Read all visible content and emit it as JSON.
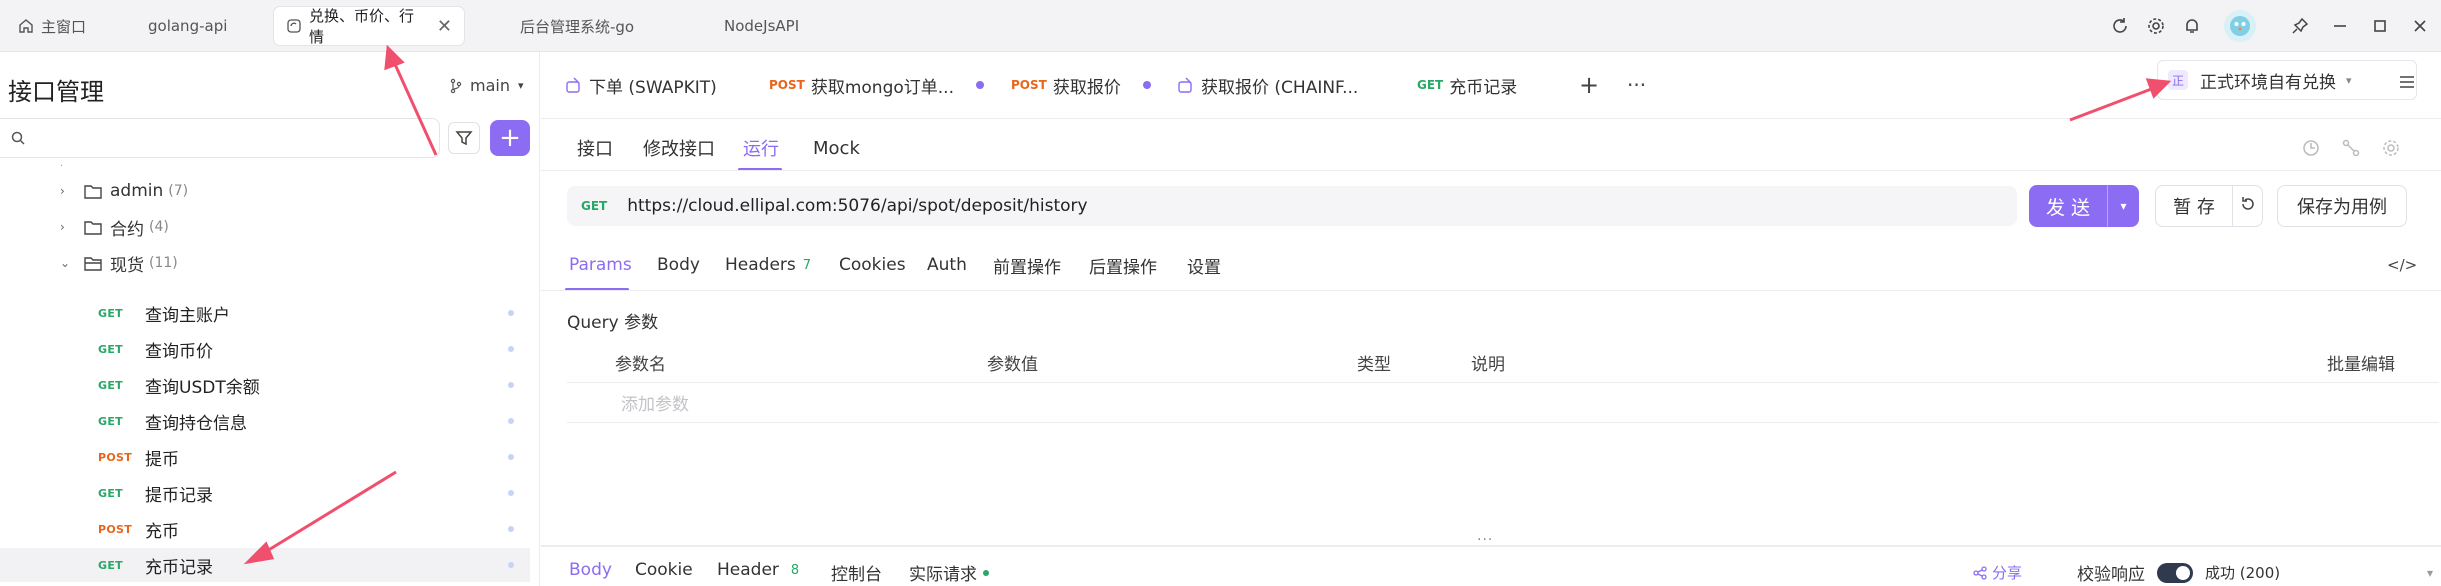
{
  "window_tabs": [
    {
      "label": "主窗口",
      "icon": "home-icon"
    },
    {
      "label": "golang-api"
    },
    {
      "label": "兑换、币价、行情",
      "icon": "tab-sync-icon",
      "active": true
    },
    {
      "label": "后台管理系统-go"
    },
    {
      "label": "NodeJsAPI"
    }
  ],
  "window_controls": [
    "refresh-icon",
    "settings-icon",
    "bell-icon",
    "avatar",
    "pin-icon",
    "minimize-icon",
    "maximize-icon",
    "close-icon"
  ],
  "sidebar": {
    "title": "接口管理",
    "branch": "main",
    "search_placeholder": "",
    "folders": [
      {
        "name": "admin",
        "count": "(7)"
      },
      {
        "name": "合约",
        "count": "(4)"
      },
      {
        "name": "现货",
        "count": "(11)"
      }
    ],
    "apis": [
      {
        "method": "GET",
        "name": "查询主账户"
      },
      {
        "method": "GET",
        "name": "查询币价"
      },
      {
        "method": "GET",
        "name": "查询USDT余额"
      },
      {
        "method": "GET",
        "name": "查询持仓信息"
      },
      {
        "method": "POST",
        "name": "提币"
      },
      {
        "method": "GET",
        "name": "提币记录"
      },
      {
        "method": "POST",
        "name": "充币"
      },
      {
        "method": "GET",
        "name": "充币记录",
        "selected": true
      }
    ]
  },
  "request_tabs": [
    {
      "method": "",
      "name": "下单 (SWAPKIT)"
    },
    {
      "method": "POST",
      "name": "获取mongo订单..."
    },
    {
      "method": "POST",
      "name": "获取报价"
    },
    {
      "method": "",
      "name": "获取报价 (CHAINF..."
    },
    {
      "method": "GET",
      "name": "充币记录"
    }
  ],
  "environment": {
    "badge": "正",
    "name": "正式环境自有兑换"
  },
  "sub_tabs": [
    "接口",
    "修改接口",
    "运行",
    "Mock"
  ],
  "active_sub_tab": "运行",
  "url_bar": {
    "method": "GET",
    "url": "https://cloud.ellipal.com:5076/api/spot/deposit/history"
  },
  "buttons": {
    "send": "发 送",
    "hold": "暂 存",
    "save_case": "保存为用例"
  },
  "param_tabs": [
    {
      "label": "Params"
    },
    {
      "label": "Body"
    },
    {
      "label": "Headers",
      "count": "7"
    },
    {
      "label": "Cookies"
    },
    {
      "label": "Auth"
    },
    {
      "label": "前置操作"
    },
    {
      "label": "后置操作"
    },
    {
      "label": "设置"
    }
  ],
  "query_section": {
    "label": "Query 参数",
    "columns": [
      "参数名",
      "参数值",
      "类型",
      "说明"
    ],
    "bulk_edit": "批量编辑",
    "add_placeholder": "添加参数"
  },
  "bottom_tabs": [
    {
      "label": "Body"
    },
    {
      "label": "Cookie"
    },
    {
      "label": "Header",
      "count": "8"
    },
    {
      "label": "控制台"
    },
    {
      "label": "实际请求"
    }
  ],
  "bottom_right": {
    "share": "分享",
    "verify": "校验响应",
    "status": "成功 (200)"
  },
  "colors": {
    "accent": "#8b6cf2",
    "get": "#27a866",
    "post": "#e8651b",
    "annotation_arrow": "#f0506e"
  }
}
